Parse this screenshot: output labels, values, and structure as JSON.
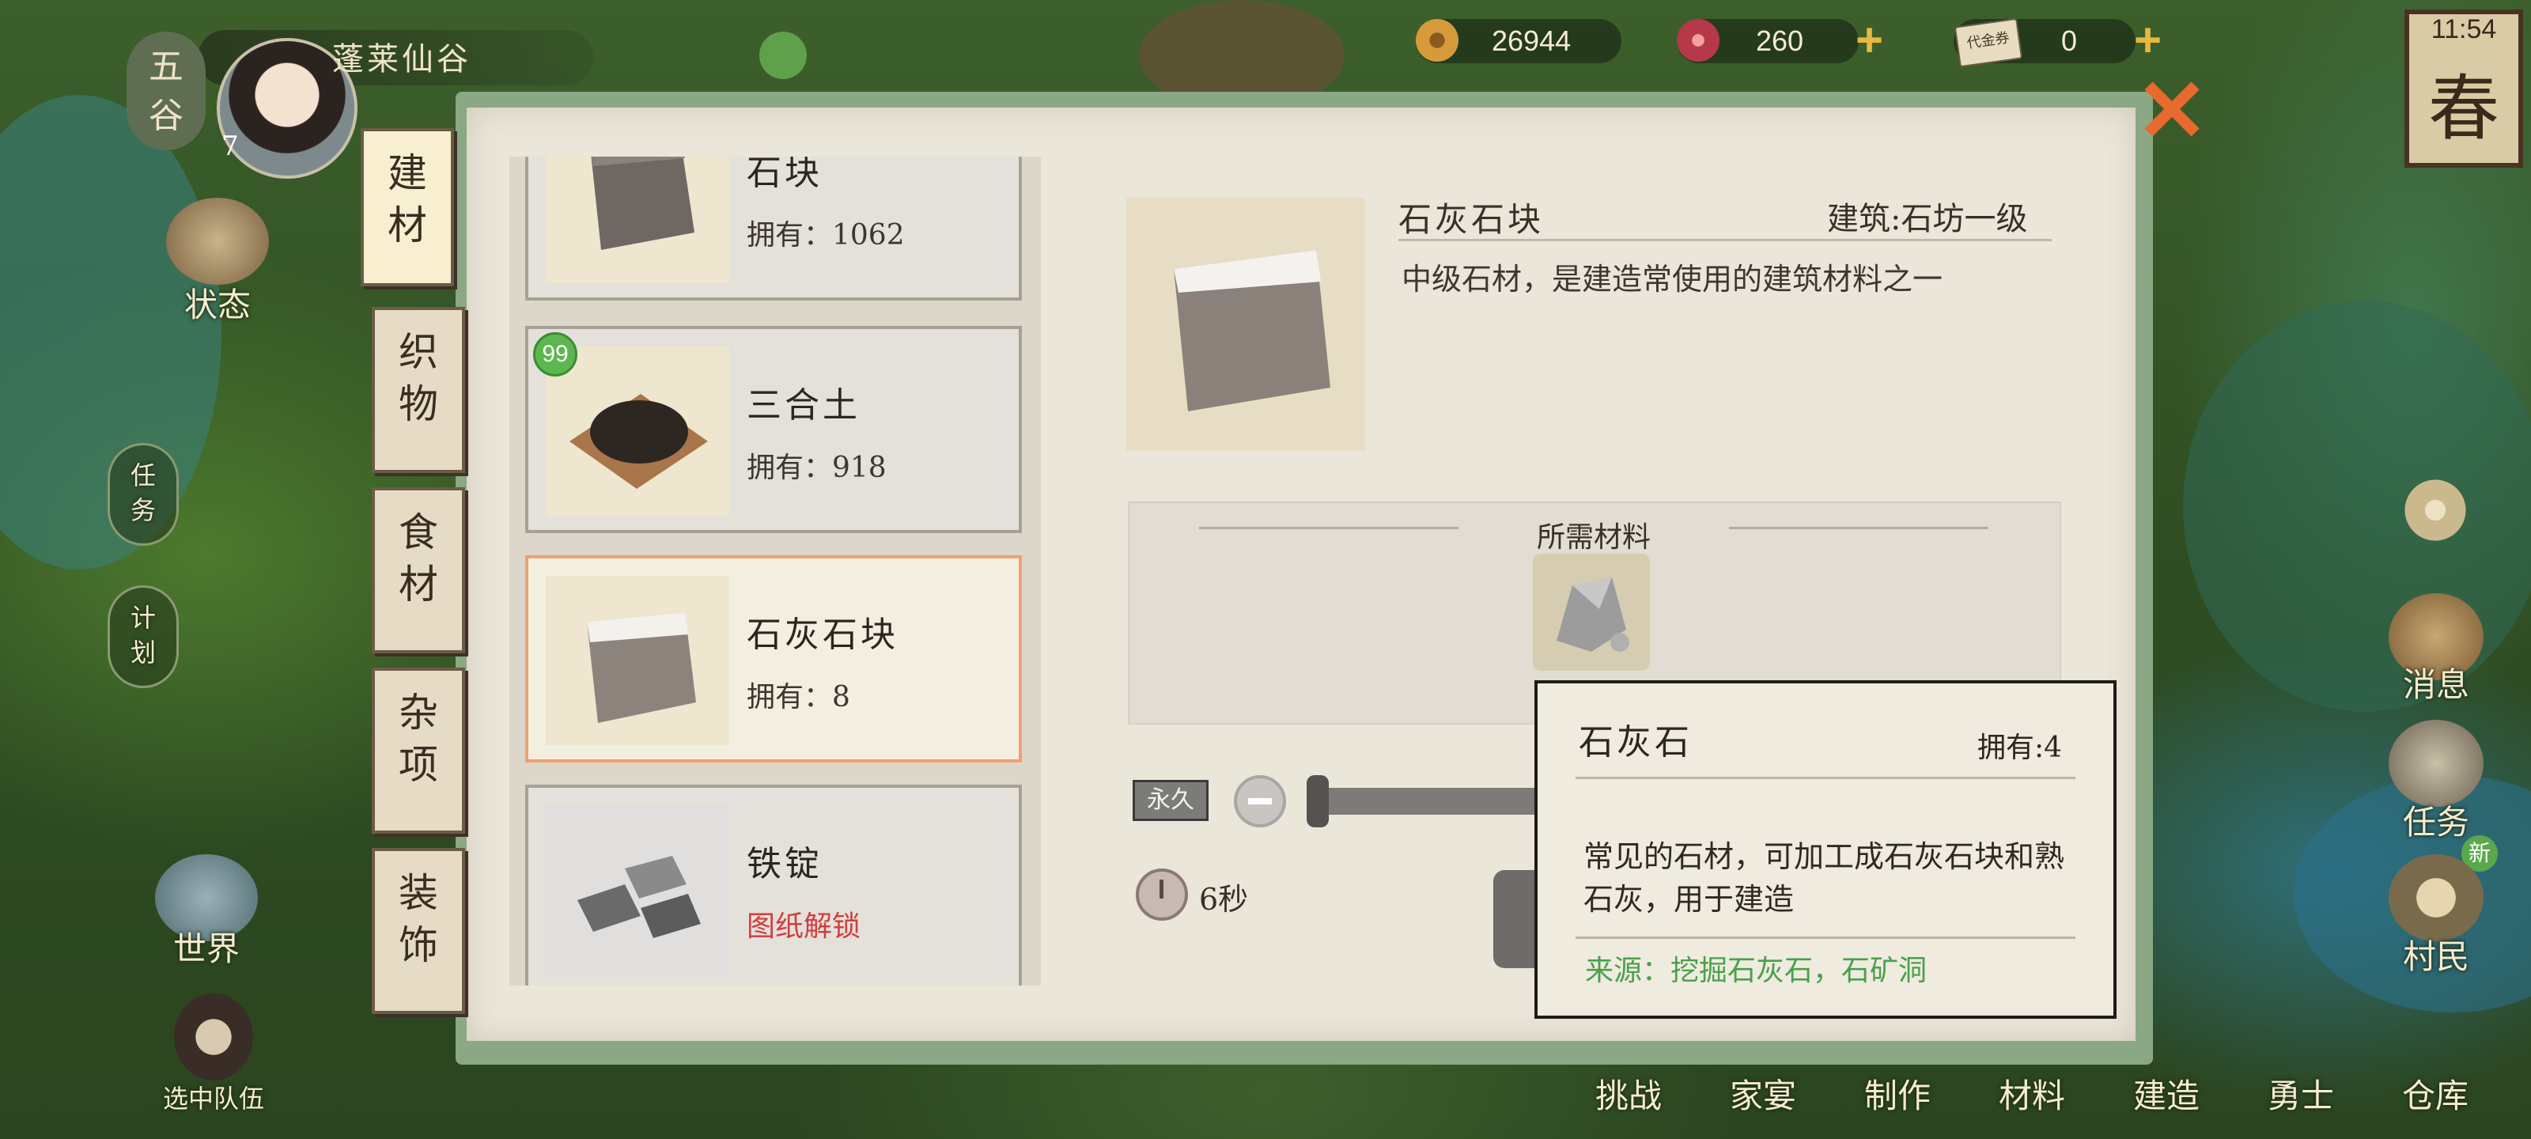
{
  "player": {
    "area_name": "蓬莱仙谷",
    "level": "7",
    "season_badge": "五谷"
  },
  "resources": {
    "coins": "26944",
    "gems": "260",
    "vouchers": "0",
    "voucher_label": "代金券"
  },
  "clock": {
    "time": "11:54",
    "season": "春"
  },
  "left_menu": {
    "status": "状态",
    "tasks": "任务",
    "plan": "计划",
    "world": "世界",
    "team": "选中队伍"
  },
  "right_menu": {
    "messages": "消息",
    "tasks": "任务",
    "new_badge": "新",
    "villagers": "村民"
  },
  "bottom_nav": [
    "挑战",
    "家宴",
    "制作",
    "材料",
    "建造",
    "勇士",
    "仓库"
  ],
  "tabs": [
    "建材",
    "织物",
    "食材",
    "杂项",
    "装饰"
  ],
  "active_tab": "建材",
  "items": [
    {
      "name": "石块",
      "own": "拥有：1062"
    },
    {
      "name": "三合土",
      "own": "拥有：918",
      "badge": "99"
    },
    {
      "name": "石灰石块",
      "own": "拥有：8",
      "selected": true
    },
    {
      "name": "铁锭",
      "own": "图纸解锁",
      "locked": true
    }
  ],
  "detail": {
    "name": "石灰石块",
    "building": "建筑:石坊一级",
    "description": "中级石材，是建造常使用的建筑材料之一",
    "required_title": "所需材料",
    "forever_label": "永久",
    "time": "6秒"
  },
  "tooltip": {
    "name": "石灰石",
    "own": "拥有:4",
    "description": "常见的石材，可加工成石灰石块和熟石灰，用于建造",
    "source": "来源：挖掘石灰石，石矿洞"
  },
  "colors": {
    "accent_orange": "#e86a2e",
    "dialog_bg": "#ebe6da",
    "source_green": "#4aa04c",
    "locked_red": "#d23d3d"
  }
}
